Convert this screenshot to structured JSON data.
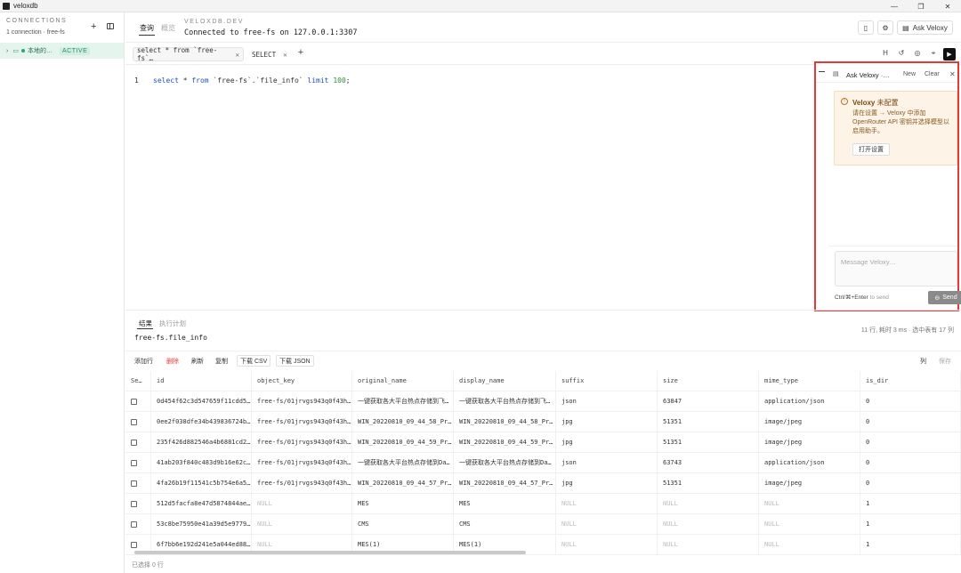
{
  "window": {
    "title": "veloxdb",
    "controls": [
      "—",
      "❐",
      "✕"
    ]
  },
  "sidebar": {
    "heading": "CONNECTIONS",
    "subtitle": "1 connection · free-fs",
    "connection": {
      "name": "本地的…",
      "badge": "ACTIVE"
    }
  },
  "header": {
    "tabs": [
      {
        "label": "查询",
        "active": true
      },
      {
        "label": "概览",
        "active": false
      }
    ],
    "brand": "VELOXDB.DEV",
    "status": "Connected to free-fs on 127.0.0.1:3307",
    "ask_button": "Ask Veloxy"
  },
  "query_tabs": [
    {
      "label": "select * from `free-fs`…",
      "active": true
    },
    {
      "label": "SELECT",
      "active": false
    }
  ],
  "editor": {
    "line_number": "1",
    "tokens": [
      {
        "t": "select",
        "c": "kw"
      },
      {
        "t": " * ",
        "c": ""
      },
      {
        "t": "from",
        "c": "kw"
      },
      {
        "t": " `free-fs`.`file_info` ",
        "c": ""
      },
      {
        "t": "limit",
        "c": "kw"
      },
      {
        "t": " ",
        "c": ""
      },
      {
        "t": "100",
        "c": "num"
      },
      {
        "t": ";",
        "c": ""
      }
    ]
  },
  "ai_panel": {
    "title": "Ask Veloxy ·…",
    "new_label": "New",
    "clear_label": "Clear",
    "warning": {
      "title_bold": "Veloxy",
      "title_rest": " 未配置",
      "body": "请在设置 → Veloxy 中添加 OpenRouter API 密钥并选择模型以启用助手。",
      "button": "打开设置"
    },
    "input_placeholder": "Message Veloxy…",
    "hint_keys": "Ctrl/⌘+Enter",
    "hint_text": " to send",
    "send_label": "Send"
  },
  "results": {
    "tabs": [
      {
        "label": "结果",
        "active": true
      },
      {
        "label": "执行计划",
        "active": false
      }
    ],
    "table_name": "free-fs.file_info",
    "stats": "11 行, 耗时 3 ms · 选中表有 17 列",
    "toolbar": {
      "add_row": "添加行",
      "delete": "删除",
      "refresh": "刷新",
      "copy": "复制",
      "download_csv": "下载 CSV",
      "download_json": "下载 JSON",
      "columns": "列",
      "save": "保存"
    },
    "columns": [
      "Se…",
      "id",
      "object_key",
      "original_name",
      "display_name",
      "suffix",
      "size",
      "mime_type",
      "is_dir"
    ],
    "rows": [
      [
        "",
        "0d454f62c3d547659f11cdd5…",
        "free-fs/01jrvgs943q0f43h…",
        "一键获取各大平台热点存储到飞…",
        "一键获取各大平台热点存储到飞…",
        "json",
        "63847",
        "application/json",
        "0"
      ],
      [
        "",
        "0ee2f038dfe34b439836724b…",
        "free-fs/01jrvgs943q0f43h…",
        "WIN_20220810_09_44_58_Pr…",
        "WIN_20220810_09_44_58_Pr…",
        "jpg",
        "51351",
        "image/jpeg",
        "0"
      ],
      [
        "",
        "235f426d882546a4b6881cd2…",
        "free-fs/01jrvgs943q0f43h…",
        "WIN_20220810_09_44_59_Pr…",
        "WIN_20220810_09_44_59_Pr…",
        "jpg",
        "51351",
        "image/jpeg",
        "0"
      ],
      [
        "",
        "41ab203f840c483d9b16e62c…",
        "free-fs/01jrvgs943q0f43h…",
        "一键获取各大平台热点存储到Da…",
        "一键获取各大平台热点存储到Da…",
        "json",
        "63743",
        "application/json",
        "0"
      ],
      [
        "",
        "4fa26b19f11541c5b754e6a5…",
        "free-fs/01jrvgs943q0f43h…",
        "WIN_20220810_09_44_57_Pr…",
        "WIN_20220810_09_44_57_Pr…",
        "jpg",
        "51351",
        "image/jpeg",
        "0"
      ],
      [
        "",
        "512d5facfa8e47d5874844ae…",
        "NULL",
        "MES",
        "MES",
        "NULL",
        "NULL",
        "NULL",
        "1"
      ],
      [
        "",
        "53c8be75950e41a39d5e9779…",
        "NULL",
        "CMS",
        "CMS",
        "NULL",
        "NULL",
        "NULL",
        "1"
      ],
      [
        "",
        "6f7bb6e192d241e5a044ed88…",
        "NULL",
        "MES(1)",
        "MES(1)",
        "NULL",
        "NULL",
        "NULL",
        "1"
      ]
    ],
    "selected_status": "已选择 0 行"
  }
}
